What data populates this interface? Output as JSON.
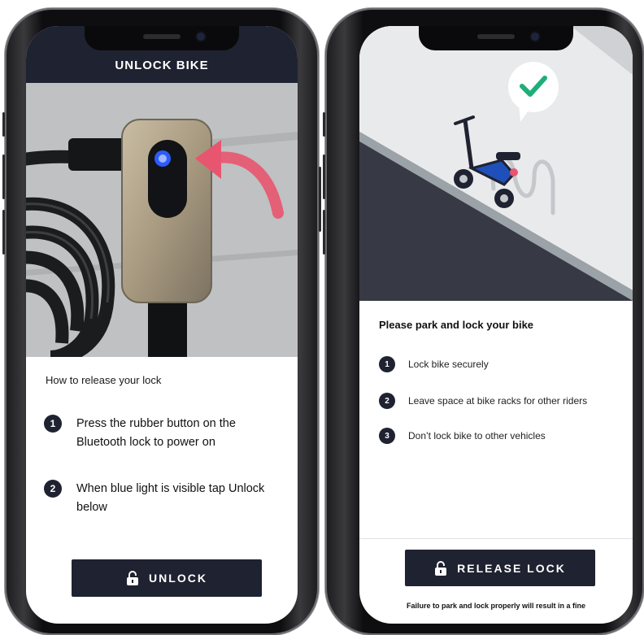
{
  "left_screen": {
    "header_title": "UNLOCK BIKE",
    "how_to_title": "How to release your lock",
    "steps": [
      {
        "number": "1",
        "text": "Press the rubber button on the Bluetooth lock to power on"
      },
      {
        "number": "2",
        "text": "When blue light is visible tap Unlock below"
      }
    ],
    "unlock_button": {
      "label": "UNLOCK",
      "icon": "padlock-open-icon"
    }
  },
  "right_screen": {
    "instructions_title": "Please park and lock your bike",
    "steps": [
      {
        "number": "1",
        "text": "Lock bike securely"
      },
      {
        "number": "2",
        "text": "Leave space at bike racks for other riders"
      },
      {
        "number": "3",
        "text": "Don’t lock bike to other vehicles"
      }
    ],
    "release_button": {
      "label": "RELEASE LOCK",
      "icon": "padlock-open-icon"
    },
    "footer_note": "Failure to park and lock properly will result in a fine",
    "illustration_icon": "checkmark-icon"
  },
  "colors": {
    "dark_navy": "#1f2230",
    "check_green": "#1fae7a",
    "arrow_pink": "#e8556f",
    "bike_blue": "#1f4fb8"
  }
}
